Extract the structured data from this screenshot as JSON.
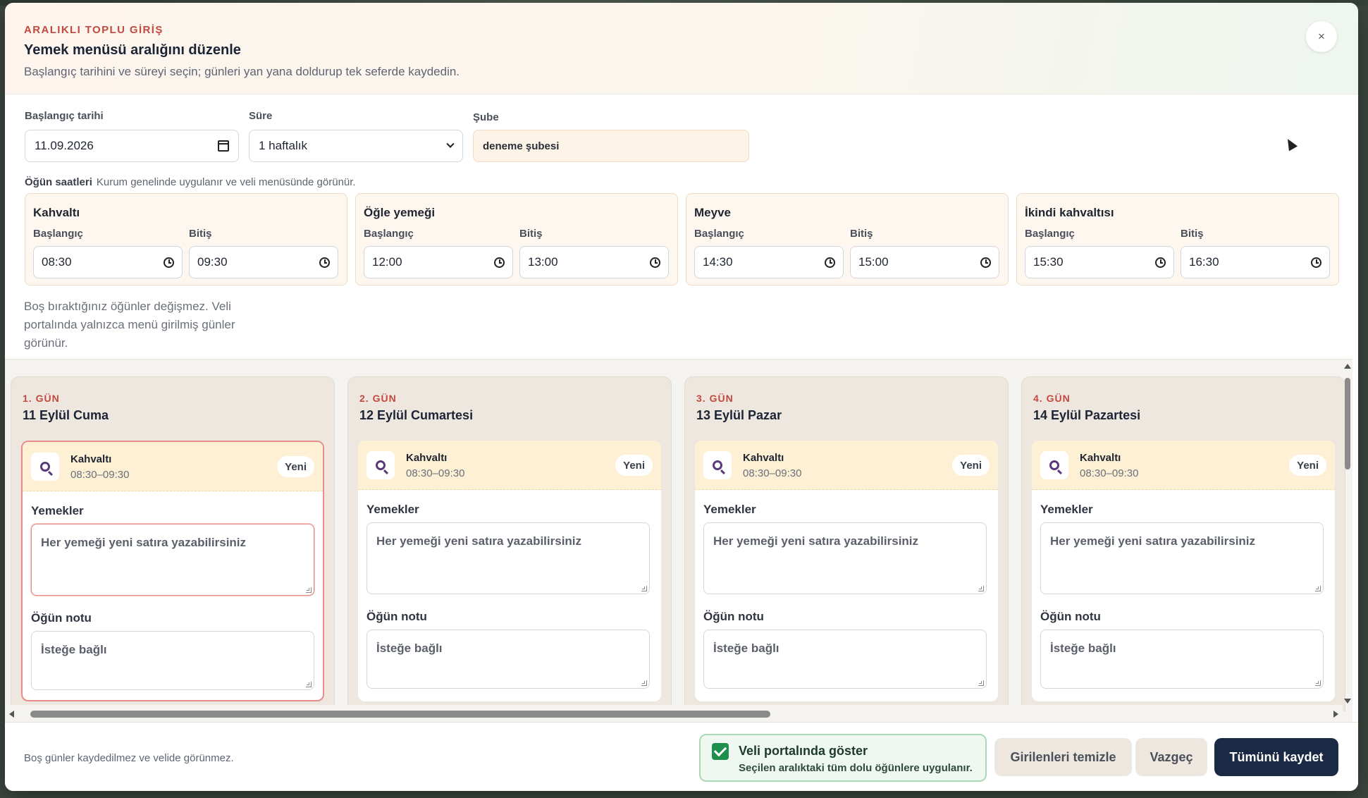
{
  "header": {
    "eyebrow": "ARALIKLI TOPLU GİRİŞ",
    "title": "Yemek menüsü aralığını düzenle",
    "subtitle": "Başlangıç tarihini ve süreyi seçin; günleri yan yana doldurup tek seferde kaydedin.",
    "close_symbol": "×"
  },
  "filters": {
    "start_date_label": "Başlangıç tarihi",
    "start_date_value": "11.09.2026",
    "duration_label": "Süre",
    "duration_value": "1 haftalık",
    "branch_label": "Şube",
    "branch_value": "deneme şubesi"
  },
  "meal_times": {
    "label": "Öğün saatleri",
    "hint": "Kurum genelinde uygulanır ve veli menüsünde görünür.",
    "start_label": "Başlangıç",
    "end_label": "Bitiş",
    "items": [
      {
        "name": "Kahvaltı",
        "start": "08:30",
        "end": "09:30"
      },
      {
        "name": "Öğle yemeği",
        "start": "12:00",
        "end": "13:00"
      },
      {
        "name": "Meyve",
        "start": "14:30",
        "end": "15:00"
      },
      {
        "name": "İkindi kahvaltısı",
        "start": "15:30",
        "end": "16:30"
      }
    ]
  },
  "empty_note": "Boş bıraktığınız öğünler değişmez. Veli portalında yalnızca menü girilmiş günler görünür.",
  "days": {
    "foods_label": "Yemekler",
    "foods_placeholder": "Her yemeği yeni satıra yazabilirsiniz",
    "note_label": "Öğün notu",
    "note_placeholder": "İsteğe bağlı",
    "new_badge": "Yeni",
    "items": [
      {
        "num": "1. GÜN",
        "name": "11 Eylül Cuma",
        "meal": "Kahvaltı",
        "time": "08:30–09:30"
      },
      {
        "num": "2. GÜN",
        "name": "12 Eylül Cumartesi",
        "meal": "Kahvaltı",
        "time": "08:30–09:30"
      },
      {
        "num": "3. GÜN",
        "name": "13 Eylül Pazar",
        "meal": "Kahvaltı",
        "time": "08:30–09:30"
      },
      {
        "num": "4. GÜN",
        "name": "14 Eylül Pazartesi",
        "meal": "Kahvaltı",
        "time": "08:30–09:30"
      }
    ]
  },
  "footer": {
    "note": "Boş günler kaydedilmez ve velide görünmez.",
    "portal_title": "Veli portalında göster",
    "portal_sub": "Seçilen aralıktaki tüm dolu öğünlere uygulanır.",
    "portal_checked": true,
    "clear_label": "Girilenleri temizle",
    "cancel_label": "Vazgeç",
    "save_label": "Tümünü kaydet"
  },
  "colors": {
    "accent_red": "#c2493e",
    "primary_navy": "#1b2a44",
    "success_green": "#1f8f4e",
    "meal_header_bg": "#fdf0d5"
  }
}
